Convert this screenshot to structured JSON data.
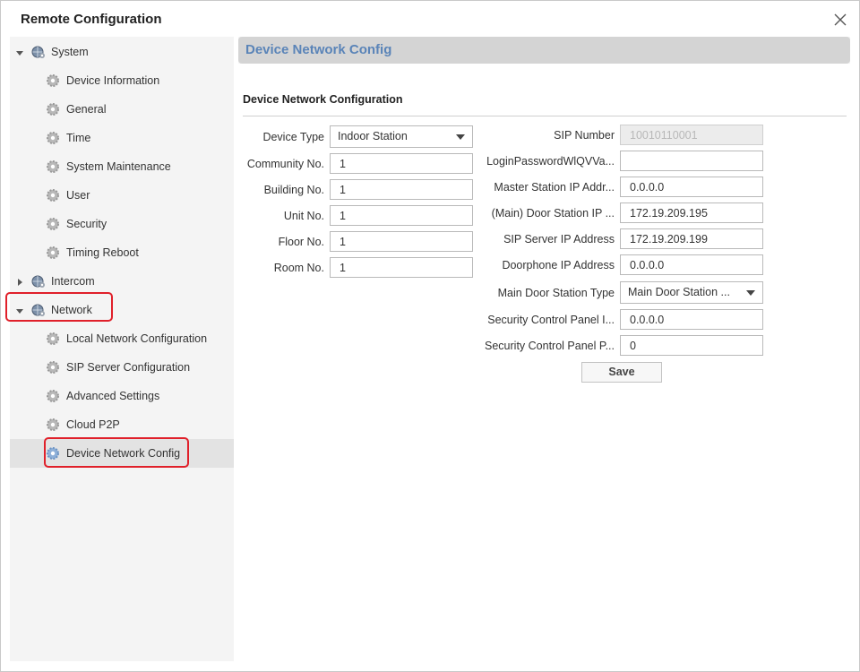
{
  "window": {
    "title": "Remote Configuration"
  },
  "sidebar": {
    "system": {
      "label": "System",
      "items": [
        "Device Information",
        "General",
        "Time",
        "System Maintenance",
        "User",
        "Security",
        "Timing Reboot"
      ]
    },
    "intercom": {
      "label": "Intercom"
    },
    "network": {
      "label": "Network",
      "items": [
        "Local Network Configuration",
        "SIP Server Configuration",
        "Advanced Settings",
        "Cloud P2P",
        "Device Network Config"
      ]
    }
  },
  "panel": {
    "header": "Device Network Config",
    "section_title": "Device Network Configuration",
    "left_fields": {
      "device_type": {
        "label": "Device Type",
        "value": "Indoor Station"
      },
      "community_no": {
        "label": "Community No.",
        "value": "1"
      },
      "building_no": {
        "label": "Building No.",
        "value": "1"
      },
      "unit_no": {
        "label": "Unit No.",
        "value": "1"
      },
      "floor_no": {
        "label": "Floor No.",
        "value": "1"
      },
      "room_no": {
        "label": "Room No.",
        "value": "1"
      }
    },
    "right_fields": {
      "sip_number": {
        "label": "SIP Number",
        "value": "10010110001"
      },
      "login_password": {
        "label": "LoginPasswordWlQVVa...",
        "value": ""
      },
      "master_station_ip": {
        "label": "Master Station IP Addr...",
        "value": "0.0.0.0"
      },
      "main_door_station_ip": {
        "label": "(Main) Door Station IP ...",
        "value": "172.19.209.195"
      },
      "sip_server_ip": {
        "label": "SIP Server IP Address",
        "value": "172.19.209.199"
      },
      "doorphone_ip": {
        "label": "Doorphone IP Address",
        "value": "0.0.0.0"
      },
      "main_door_station_type": {
        "label": "Main Door Station Type",
        "value": "Main Door Station ..."
      },
      "security_panel_ip": {
        "label": "Security Control Panel I...",
        "value": "0.0.0.0"
      },
      "security_panel_port": {
        "label": "Security Control Panel P...",
        "value": "0"
      }
    },
    "save_label": "Save"
  },
  "colors": {
    "highlight": "#e0202a",
    "header_text": "#5a84b8"
  }
}
